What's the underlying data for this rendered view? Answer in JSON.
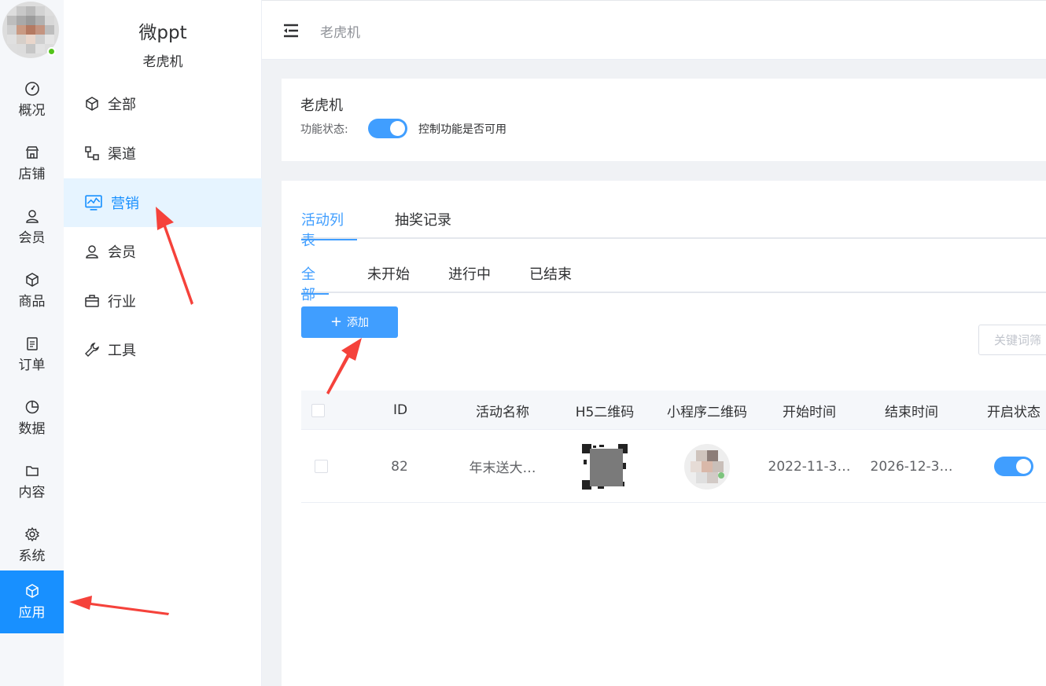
{
  "app": {
    "brand": "微ppt",
    "brand_sub": "老虎机"
  },
  "rail": {
    "items": [
      {
        "label": "概况",
        "icon": "dashboard-icon"
      },
      {
        "label": "店铺",
        "icon": "shop-icon"
      },
      {
        "label": "会员",
        "icon": "user-icon"
      },
      {
        "label": "商品",
        "icon": "cube-icon"
      },
      {
        "label": "订单",
        "icon": "clipboard-icon"
      },
      {
        "label": "数据",
        "icon": "pie-chart-icon"
      },
      {
        "label": "内容",
        "icon": "folder-icon"
      },
      {
        "label": "系统",
        "icon": "gear-icon"
      },
      {
        "label": "应用",
        "icon": "cube-icon",
        "active": true
      }
    ]
  },
  "submenu": {
    "items": [
      {
        "label": "全部",
        "icon": "cube-icon"
      },
      {
        "label": "渠道",
        "icon": "channel-icon"
      },
      {
        "label": "营销",
        "icon": "monitor-chart-icon",
        "active": true
      },
      {
        "label": "会员",
        "icon": "user-icon"
      },
      {
        "label": "行业",
        "icon": "briefcase-icon"
      },
      {
        "label": "工具",
        "icon": "wrench-icon"
      }
    ]
  },
  "header": {
    "breadcrumb": "老虎机"
  },
  "feature": {
    "title": "老虎机",
    "status_label": "功能状态:",
    "status_on": true,
    "hint": "控制功能是否可用"
  },
  "tabs": {
    "main": [
      "活动列表",
      "抽奖记录"
    ],
    "main_active": 0,
    "sub": [
      "全部",
      "未开始",
      "进行中",
      "已结束"
    ],
    "sub_active": 0
  },
  "toolbar": {
    "add_label": "添加",
    "search_placeholder": "关键词筛"
  },
  "table": {
    "headers": [
      "ID",
      "活动名称",
      "H5二维码",
      "小程序二维码",
      "开始时间",
      "结束时间",
      "开启状态"
    ],
    "rows": [
      {
        "id": "82",
        "name": "年末送大…",
        "start": "2022-11-3…",
        "end": "2026-12-3…",
        "enabled": true
      }
    ]
  },
  "colors": {
    "primary": "#409eff",
    "rail_active": "#1890ff",
    "annotation": "#f5423b"
  }
}
